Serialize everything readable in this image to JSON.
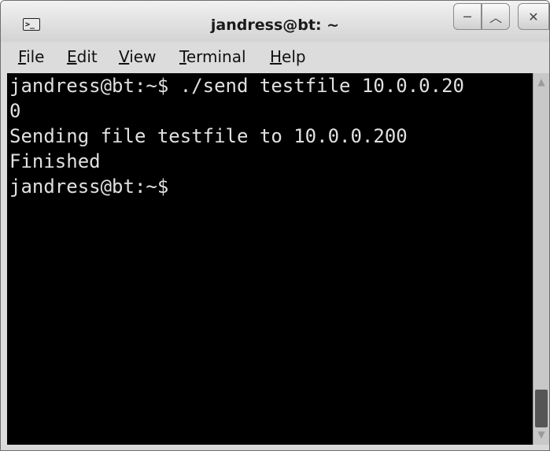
{
  "window": {
    "title": "jandress@bt: ~",
    "app_icon_glyph": ">_",
    "controls": {
      "minimize": "─",
      "maximize": "︿",
      "close": "✕"
    }
  },
  "menubar": {
    "items": [
      "File",
      "Edit",
      "View",
      "Terminal",
      "Help"
    ]
  },
  "terminal": {
    "lines": [
      "jandress@bt:~$ ./send testfile 10.0.0.20",
      "0",
      "Sending file testfile to 10.0.0.200",
      "Finished",
      "jandress@bt:~$"
    ],
    "background": "#000000",
    "foreground": "#e0e0e0"
  },
  "scrollbar": {
    "up_arrow": "▲",
    "down_arrow": "▼"
  }
}
